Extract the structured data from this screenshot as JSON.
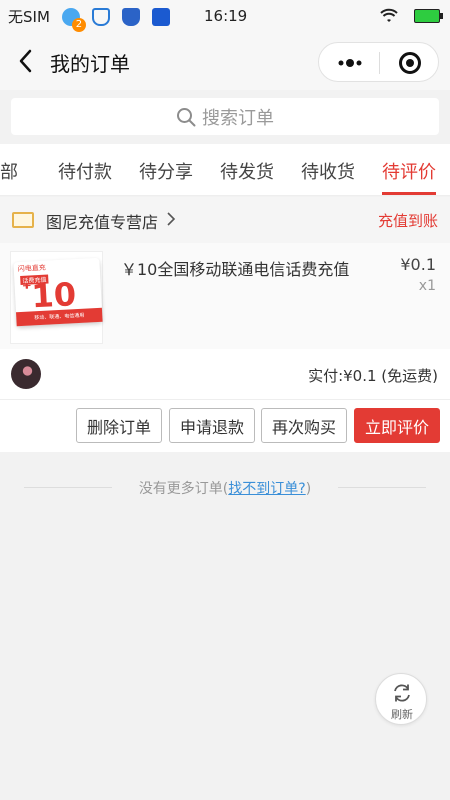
{
  "status_bar": {
    "carrier": "无SIM",
    "qq_badge": "2",
    "time": "16:19",
    "icons": [
      "qq-icon",
      "shield-check-icon",
      "shield-icon",
      "security-icon",
      "wifi-icon",
      "battery-icon"
    ],
    "battery_color": "#2ecc40"
  },
  "nav": {
    "title": "我的订单",
    "icons": [
      "back-arrow-icon",
      "more-dots-icon",
      "target-circle-icon"
    ]
  },
  "search": {
    "placeholder": "搜索订单"
  },
  "tabs": [
    {
      "label": "全部",
      "active": false
    },
    {
      "label": "待付款",
      "active": false
    },
    {
      "label": "待分享",
      "active": false
    },
    {
      "label": "待发货",
      "active": false
    },
    {
      "label": "待收货",
      "active": false
    },
    {
      "label": "待评价",
      "active": true
    }
  ],
  "order": {
    "shop_name": "图尼充值专营店",
    "status": "充值到账",
    "product": {
      "title": "￥10全国移动联通电信话费充值",
      "price": "¥0.1",
      "quantity": "x1",
      "image": {
        "brand": "闪电直充",
        "tag": "话费充值",
        "amount_symbol": "¥",
        "amount": "10",
        "footer": "移动、联通、电信通用"
      }
    },
    "payment": "实付:¥0.1 (免运费)",
    "buttons": {
      "delete": "删除订单",
      "refund": "申请退款",
      "rebuy": "再次购买",
      "review": "立即评价"
    }
  },
  "footer": {
    "no_more": "没有更多订单(",
    "link": "找不到订单?",
    "close_paren": ")"
  },
  "refresh": {
    "label": "刷新"
  },
  "colors": {
    "accent": "#e33b34",
    "link": "#3a8fd8",
    "background": "#f2f2f2"
  }
}
